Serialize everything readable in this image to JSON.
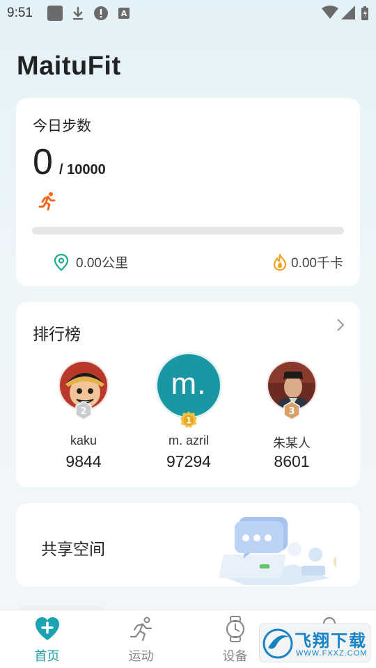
{
  "status_bar": {
    "time": "9:51",
    "icons": [
      "square-notification-icon",
      "download-icon",
      "alert-icon",
      "a-icon",
      "wifi-icon",
      "signal-icon",
      "battery-icon"
    ]
  },
  "app": {
    "title": "MaituFit"
  },
  "steps_card": {
    "title": "今日步数",
    "value": "0",
    "goal": "/ 10000",
    "progress_fraction": 0,
    "distance": "0.00公里",
    "calories": "0.00千卡",
    "accent_color": "#19a0a8",
    "run_icon_color": "#f06a1e"
  },
  "leaderboard": {
    "title": "排行榜",
    "users": [
      {
        "rank": "2",
        "name": "kaku",
        "score": "9844"
      },
      {
        "rank": "1",
        "name": "m. azril",
        "score": "97294",
        "avatar_letter": "m."
      },
      {
        "rank": "3",
        "name": "朱某人",
        "score": "8601"
      }
    ]
  },
  "share": {
    "title": "共享空间"
  },
  "tabs": [
    {
      "label": "首页",
      "icon": "heart-plus-icon",
      "active": true
    },
    {
      "label": "运动",
      "icon": "runner-icon",
      "active": false
    },
    {
      "label": "设备",
      "icon": "watch-icon",
      "active": false
    },
    {
      "label": "",
      "icon": "profile-icon",
      "active": false
    }
  ],
  "watermark": {
    "text": "飞翔下载",
    "url": "WWW.FXXZ.COM"
  }
}
